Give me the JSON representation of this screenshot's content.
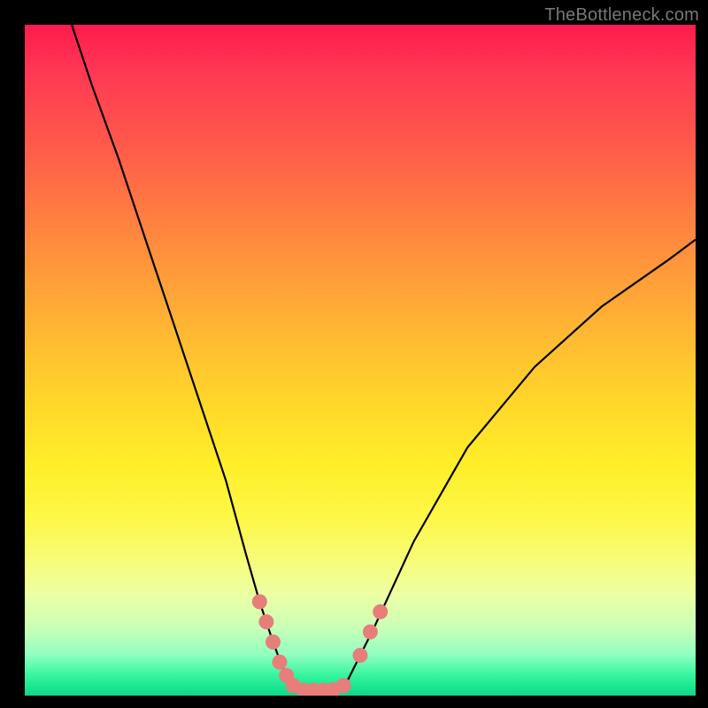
{
  "watermark": "TheBottleneck.com",
  "chart_data": {
    "type": "line",
    "title": "",
    "xlabel": "",
    "ylabel": "",
    "xlim": [
      0,
      100
    ],
    "ylim": [
      0,
      100
    ],
    "series": [
      {
        "name": "curve",
        "x": [
          7,
          10,
          14,
          18,
          22,
          26,
          30,
          33,
          35,
          37,
          38.5,
          40,
          42,
          44,
          46,
          48,
          52,
          58,
          66,
          76,
          86,
          96,
          100
        ],
        "y": [
          100,
          91,
          80,
          68,
          56,
          44,
          32,
          21,
          14,
          8,
          4,
          1.5,
          0.8,
          0.8,
          0.9,
          2,
          10,
          23,
          37,
          49,
          58,
          65,
          68
        ]
      }
    ],
    "markers": [
      {
        "name": "marker-dot",
        "x": 35.0,
        "y": 14.0
      },
      {
        "name": "marker-dot",
        "x": 36.0,
        "y": 11.0
      },
      {
        "name": "marker-dot",
        "x": 37.0,
        "y": 8.0
      },
      {
        "name": "marker-dot",
        "x": 38.0,
        "y": 5.0
      },
      {
        "name": "marker-dot",
        "x": 39.0,
        "y": 3.0
      },
      {
        "name": "marker-dot",
        "x": 40.0,
        "y": 1.5
      },
      {
        "name": "marker-dot",
        "x": 41.5,
        "y": 0.8
      },
      {
        "name": "marker-dot",
        "x": 43.0,
        "y": 0.8
      },
      {
        "name": "marker-dot",
        "x": 44.5,
        "y": 0.8
      },
      {
        "name": "marker-dot",
        "x": 46.0,
        "y": 0.9
      },
      {
        "name": "marker-dot",
        "x": 47.5,
        "y": 1.5
      },
      {
        "name": "marker-dot",
        "x": 50.0,
        "y": 6.0
      },
      {
        "name": "marker-dot",
        "x": 51.5,
        "y": 9.5
      },
      {
        "name": "marker-dot",
        "x": 53.0,
        "y": 12.5
      }
    ],
    "colors": {
      "curve": "#000000",
      "marker_fill": "#e77e7a",
      "gradient_top": "#ff1a4d",
      "gradient_mid": "#ffef2a",
      "gradient_bottom": "#17e28e",
      "frame": "#000000"
    }
  }
}
